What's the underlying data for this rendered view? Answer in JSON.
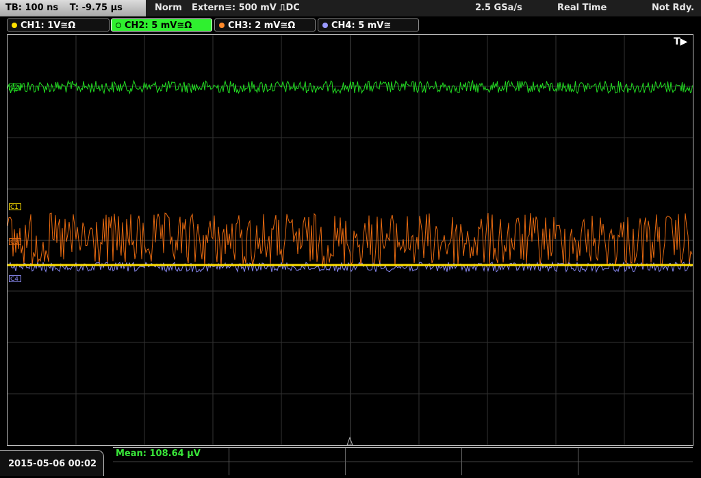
{
  "header": {
    "timebase": "TB: 100 ns",
    "trigger_time": "T: -9.75 µs",
    "mode": "Norm",
    "trigger_source": "Extern≅: 500 mV ⎍DC",
    "sample_rate": "2.5 GSa/s",
    "acquisition": "Real Time",
    "status": "Not Rdy."
  },
  "channels": [
    {
      "id": "ch1",
      "label": "CH1: 1V≅Ω",
      "color": "#ffd800",
      "active": false
    },
    {
      "id": "ch2",
      "label": "CH2: 5 mV≅Ω",
      "color": "#30e030",
      "active": true
    },
    {
      "id": "ch3",
      "label": "CH3: 2 mV≅Ω",
      "color": "#ff8a2a",
      "active": false
    },
    {
      "id": "ch4",
      "label": "CH4: 5 mV≅",
      "color": "#9a9aff",
      "active": false
    }
  ],
  "markers": {
    "trigger_pos": "T▶",
    "c2": "C2",
    "c1": "C1",
    "c3": "C3",
    "c4": "C4"
  },
  "footer": {
    "datetime": "2015-05-06 00:02",
    "measurement": "Mean: 108.64 µV"
  },
  "colors": {
    "ch1": "#ffe000",
    "ch2": "#22dd22",
    "ch3": "#e86a10",
    "ch4": "#8888ee",
    "grid": "#3a3a3a"
  }
}
